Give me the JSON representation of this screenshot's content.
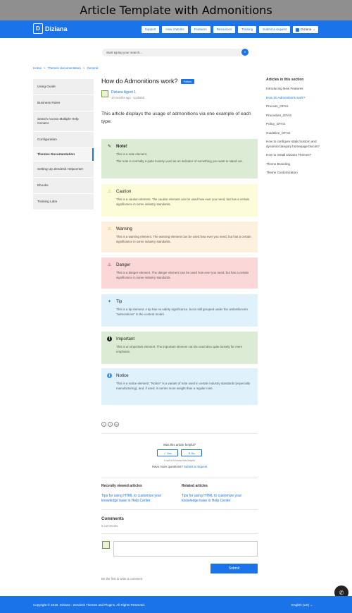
{
  "banner": {
    "title": "Article Template with Admonitions"
  },
  "header": {
    "logo": "Diziana",
    "nav": [
      "Support",
      "How it Works",
      "Features",
      "Resources",
      "Training",
      "Submit a request"
    ],
    "user": "Diziana"
  },
  "search": {
    "placeholder": "Start typing your search..."
  },
  "breadcrumb": [
    "Home",
    "Themes documentation",
    "General"
  ],
  "sidebar": {
    "items": [
      {
        "label": "Using Guide"
      },
      {
        "label": "Business Rules"
      },
      {
        "label": "Search Across Multiple Help Centers"
      },
      {
        "label": "Configuration"
      },
      {
        "label": "Themes Documentation"
      },
      {
        "label": "Setting Up Zendesk Helpcenter"
      },
      {
        "label": "Ebooks"
      },
      {
        "label": "Training Labs"
      }
    ]
  },
  "article": {
    "title": "How do Admonitions work?",
    "follow": "Follow",
    "author": "Diziana Agent 1",
    "meta": "10 months ago · Updated",
    "intro": "This article displays the usage of admonitions via one example of each type:"
  },
  "admonitions": [
    {
      "title": "Note!",
      "icon": "✎",
      "lines": [
        "This is a note element.",
        "The note is normally a quite loosely used as an indicator of something you want to stand out."
      ]
    },
    {
      "title": "Caution",
      "icon": "⚠",
      "lines": [
        "This is a caution element. The caution element can be used how ever you need, but has a certain significance in some industry standards."
      ]
    },
    {
      "title": "Warning",
      "icon": "⚠",
      "lines": [
        "This is a warning element. The warning element can be used how ever you need, but has a certain significance in some industry standards."
      ]
    },
    {
      "title": "Danger",
      "icon": "⚠",
      "lines": [
        "This is a danger element. The danger element can be used how ever you need, but has a certain significance in some industry standards."
      ]
    },
    {
      "title": "Tip",
      "icon": "✦",
      "lines": [
        "This is a tip element. A tip has no safety significance, but is still grouped under the umbrella term \"admonitions\" in the content model."
      ]
    },
    {
      "title": "Important",
      "icon": "!",
      "lines": [
        "This is an important element. The important element can be used also quite loosely for mere emphasis."
      ]
    },
    {
      "title": "Notice",
      "icon": "i",
      "lines": [
        "This is a notice element. \"Notice\" is a variant of note used in certain industry standards (especially manufacturing), and, if used, it carries more weight than a regular note."
      ]
    }
  ],
  "colors": {
    "primary": "#1a73e8",
    "note": "#dcecd4",
    "caution": "#fdfcd8",
    "warning": "#fdf0dc",
    "danger": "#fbd7d7",
    "tip": "#dff1fb",
    "important": "#dcecd4",
    "notice": "#dff1fb"
  },
  "share": [
    "f",
    "t",
    "in"
  ],
  "feedback": {
    "question": "Was this article helpful?",
    "yes": "✓ Yes",
    "no": "✕ No",
    "found": "0 out of 0 found this helpful",
    "more": "Have more questions?",
    "submit_link": "Submit a request"
  },
  "recent": {
    "title": "Recently viewed articles",
    "link": "Tips for using HTML to customize your knowledge base in Help Center"
  },
  "related": {
    "title": "Related articles",
    "link": "Tips for using HTML to customize your knowledge base in Help Center"
  },
  "comments": {
    "title": "Comments",
    "count": "0 comments",
    "submit": "Submit",
    "first": "Be the first to write a comment."
  },
  "right": {
    "title": "Articles in this section",
    "items": [
      {
        "label": "Introducing New Features"
      },
      {
        "label": "How do Admonitions work?"
      },
      {
        "label": "Process_GFAS"
      },
      {
        "label": "Procedure_GFAS"
      },
      {
        "label": "Policy_GFAS"
      },
      {
        "label": "Guideline_GFAS"
      },
      {
        "label": "How to configure static/custom and dynamic/category homepage blocks?"
      },
      {
        "label": "How to install Diziana Themes?"
      },
      {
        "label": "Theme Branding"
      },
      {
        "label": "Theme Customization"
      }
    ]
  },
  "footer": {
    "copyright": "Copyright © 2019. Diziana - Zendesk Themes and Plugins. All Rights Reserved.",
    "language": "English (US)  ⌄"
  }
}
